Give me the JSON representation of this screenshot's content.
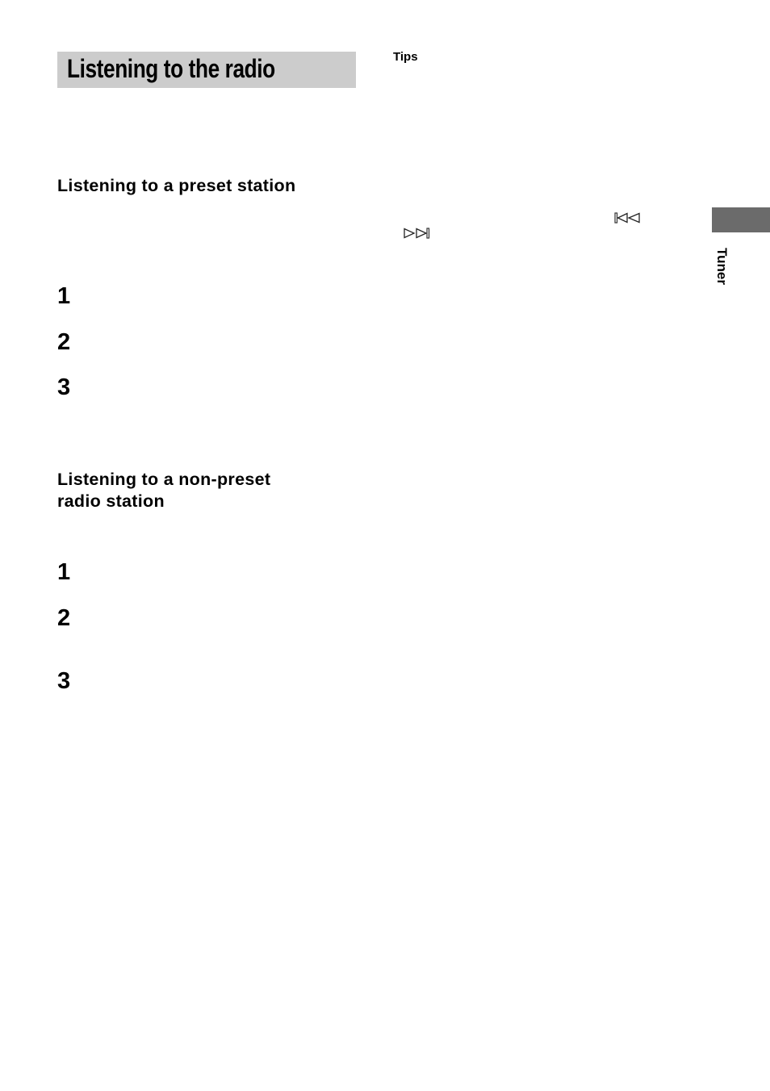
{
  "page": {
    "title": "Listening to the radio",
    "side_tab": {
      "label": "Tuner",
      "color": "#6b6b6b"
    },
    "title_box_color": "#cccccc"
  },
  "left_column": {
    "sections": [
      {
        "heading": "Listening to a preset station",
        "steps": [
          "1",
          "2",
          "3"
        ]
      },
      {
        "heading_line1": "Listening to a non-preset",
        "heading_line2": "radio station",
        "steps": [
          "1",
          "2",
          "3"
        ]
      }
    ]
  },
  "right_column": {
    "tips_label": "Tips",
    "icons": [
      {
        "name": "previous-track-icon",
        "glyph": "⏮"
      },
      {
        "name": "next-track-icon",
        "glyph": "⏭"
      }
    ]
  }
}
